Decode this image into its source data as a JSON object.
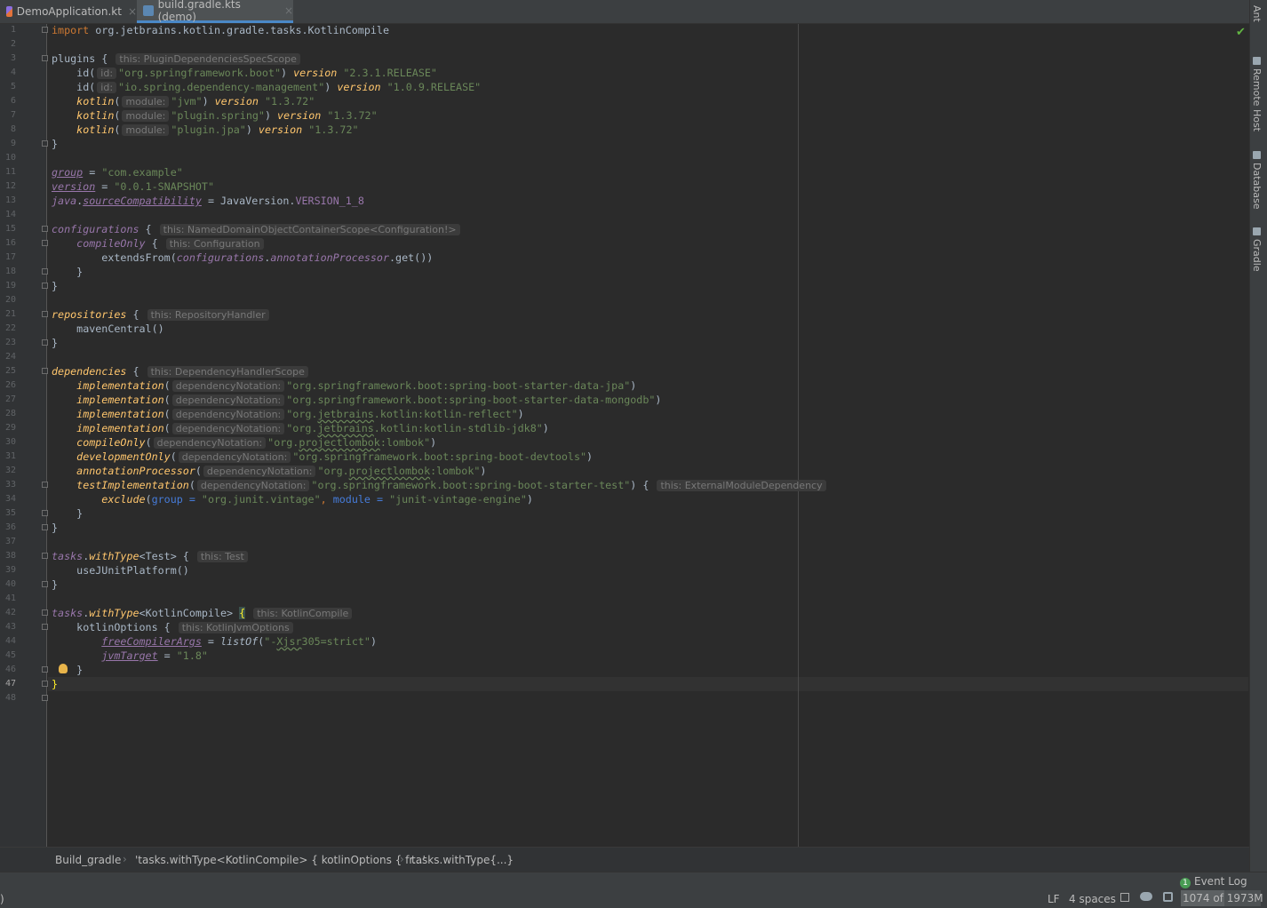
{
  "tabs": [
    {
      "label": "DemoApplication.kt",
      "close": "×",
      "active": false
    },
    {
      "label": "build.gradle.kts (demo)",
      "close": "×",
      "active": true
    }
  ],
  "tool_windows": [
    "Ant",
    "Remote Host",
    "Database",
    "Gradle"
  ],
  "line_numbers": [
    "1",
    "2",
    "3",
    "4",
    "5",
    "6",
    "7",
    "8",
    "9",
    "10",
    "11",
    "12",
    "13",
    "14",
    "15",
    "16",
    "17",
    "18",
    "19",
    "20",
    "21",
    "22",
    "23",
    "24",
    "25",
    "26",
    "27",
    "28",
    "29",
    "30",
    "31",
    "32",
    "33",
    "34",
    "35",
    "36",
    "37",
    "38",
    "39",
    "40",
    "41",
    "42",
    "43",
    "44",
    "45",
    "46",
    "47",
    "48"
  ],
  "code": {
    "l1": [
      "import",
      " org.jetbrains.kotlin.gradle.tasks.KotlinCompile"
    ],
    "l3": [
      "plugins { ",
      "this: PluginDependenciesSpecScope"
    ],
    "l4": [
      "id(",
      "id:",
      "\"org.springframework.boot\"",
      ") ",
      "version",
      " ",
      "\"2.3.1.RELEASE\""
    ],
    "l5": [
      "id(",
      "id:",
      "\"io.spring.dependency-management\"",
      ") ",
      "version",
      " ",
      "\"1.0.9.RELEASE\""
    ],
    "l6": [
      "kotlin",
      "(",
      "module:",
      "\"jvm\"",
      ") ",
      "version",
      " ",
      "\"1.3.72\""
    ],
    "l7": [
      "kotlin",
      "(",
      "module:",
      "\"plugin.spring\"",
      ") ",
      "version",
      " ",
      "\"1.3.72\""
    ],
    "l8": [
      "kotlin",
      "(",
      "module:",
      "\"plugin.jpa\"",
      ") ",
      "version",
      " ",
      "\"1.3.72\""
    ],
    "l9": "}",
    "l11": [
      "group",
      " = ",
      "\"com.example\""
    ],
    "l12": [
      "version",
      " = ",
      "\"0.0.1-SNAPSHOT\""
    ],
    "l13": [
      "java",
      ".",
      "sourceCompatibility",
      " = JavaVersion.",
      "VERSION_1_8"
    ],
    "l15": [
      "configurations",
      " { ",
      "this: NamedDomainObjectContainerScope<Configuration!>"
    ],
    "l16": [
      "compileOnly",
      " { ",
      "this: Configuration"
    ],
    "l17": [
      "extendsFrom(",
      "configurations",
      ".",
      "annotationProcessor",
      ".get())"
    ],
    "l18": "}",
    "l19": "}",
    "l21": [
      "repositories",
      " { ",
      "this: RepositoryHandler"
    ],
    "l22": "mavenCentral()",
    "l23": "}",
    "l25": [
      "dependencies",
      " { ",
      "this: DependencyHandlerScope"
    ],
    "l26": [
      "implementation",
      "(",
      "dependencyNotation:",
      "\"org.springframework.boot:spring-boot-starter-data-jpa\"",
      ")"
    ],
    "l27": [
      "implementation",
      "(",
      "dependencyNotation:",
      "\"org.springframework.boot:spring-boot-starter-data-mongodb\"",
      ")"
    ],
    "l28": [
      "implementation",
      "(",
      "dependencyNotation:",
      "\"org.",
      "jetbrains",
      ".kotlin:kotlin-reflect\"",
      ")"
    ],
    "l29": [
      "implementation",
      "(",
      "dependencyNotation:",
      "\"org.",
      "jetbrains",
      ".kotlin:kotlin-stdlib-jdk8\"",
      ")"
    ],
    "l30": [
      "compileOnly",
      "(",
      "dependencyNotation:",
      "\"org.",
      "projectlombok",
      ":lombok\"",
      ")"
    ],
    "l31": [
      "developmentOnly",
      "(",
      "dependencyNotation:",
      "\"org.springframework.boot:spring-boot-devtools\"",
      ")"
    ],
    "l32": [
      "annotationProcessor",
      "(",
      "dependencyNotation:",
      "\"org.",
      "projectlombok",
      ":lombok\"",
      ")"
    ],
    "l33": [
      "testImplementation",
      "(",
      "dependencyNotation:",
      "\"org.springframework.boot:spring-boot-starter-test\"",
      ") { ",
      "this: ExternalModuleDependency"
    ],
    "l34": [
      "exclude",
      "(",
      "group",
      " = ",
      "\"org.junit.vintage\"",
      ", ",
      "module",
      " = ",
      "\"junit-vintage-engine\"",
      ")"
    ],
    "l35": "}",
    "l36": "}",
    "l38": [
      "tasks",
      ".",
      "withType",
      "<Test> { ",
      "this: Test"
    ],
    "l39": "useJUnitPlatform()",
    "l40": "}",
    "l42": [
      "tasks",
      ".",
      "withType",
      "<KotlinCompile> ",
      "{",
      " ",
      "this: KotlinCompile"
    ],
    "l43": [
      "kotlinOptions { ",
      "this: KotlinJvmOptions"
    ],
    "l44": [
      "freeCompilerArgs",
      " = ",
      "listOf",
      "(",
      "\"-",
      "Xjsr",
      "305=strict\"",
      ")"
    ],
    "l45": [
      "jvmTarget",
      " = ",
      "\"1.8\""
    ],
    "l46": "}",
    "l47": "}"
  },
  "breadcrumbs": [
    "Build_gradle",
    "'tasks.withType<KotlinCompile> { kotlinOptions { fr...'",
    "tasks.withType{...}"
  ],
  "breadcrumb_sep": "›",
  "status": {
    "event_log_count": "1",
    "event_log": "Event Log",
    "left_char": ")",
    "line_sep": "LF",
    "indent": "4 spaces",
    "memory": "1074 of 1973M",
    "memory_fraction": 0.544
  },
  "colors": {
    "keyword": "#cc7832",
    "string": "#6a8759",
    "function": "#ffc66d",
    "property": "#9876aa",
    "named_arg": "#467cda",
    "text": "#a9b7c6"
  },
  "icons": [
    "kotlin-file-icon",
    "gradle-kts-file-icon",
    "close-icon",
    "checkmark-icon",
    "lightbulb-icon",
    "fold-icon",
    "lock-icon",
    "git-icon",
    "memory-indicator-icon"
  ]
}
